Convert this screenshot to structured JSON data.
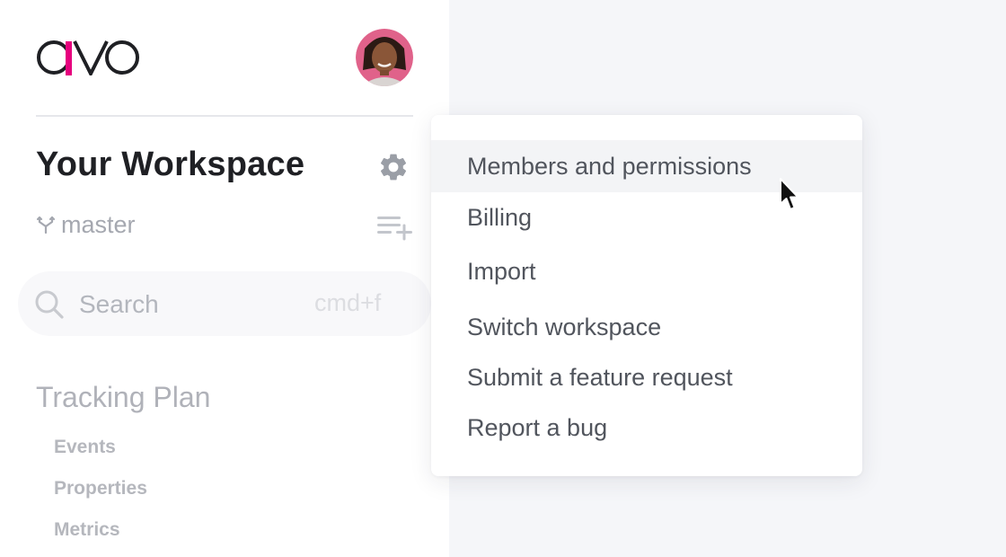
{
  "brand": {
    "logo_text": "avo",
    "accent_color": "#e6007e"
  },
  "header": {
    "avatar_alt": "User avatar"
  },
  "workspace": {
    "title": "Your Workspace",
    "settings_icon": "gear-icon",
    "branch_icon": "branch-icon",
    "branch": "master",
    "add_icon": "playlist-add-icon"
  },
  "search": {
    "placeholder": "Search",
    "shortcut": "cmd+f",
    "icon": "search-icon"
  },
  "nav": {
    "section_title": "Tracking Plan",
    "items": [
      {
        "label": "Events"
      },
      {
        "label": "Properties"
      },
      {
        "label": "Metrics"
      }
    ]
  },
  "dropdown": {
    "items": [
      {
        "label": "Members and permissions",
        "active": true
      },
      {
        "label": "Billing"
      },
      {
        "label": "Import"
      },
      {
        "label": "Switch workspace"
      },
      {
        "label": "Submit a feature request"
      },
      {
        "label": "Report a bug"
      }
    ]
  },
  "colors": {
    "sidebar_bg": "#ffffff",
    "main_bg": "#f5f6f9",
    "title_text": "#1f2024",
    "muted_text": "#a5a8b0",
    "menu_text": "#51555d",
    "menu_hover_bg": "#f3f4f6"
  }
}
